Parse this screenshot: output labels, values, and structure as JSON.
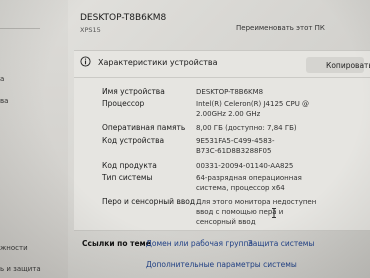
{
  "sidebar": {
    "items": [
      "а",
      "ва",
      "жности",
      "ь и защита"
    ]
  },
  "header": {
    "device_name": "DESKTOP-T8B6KM8",
    "model": "XPS15",
    "rename_label": "Переименовать этот ПК"
  },
  "panel": {
    "title": "Характеристики устройства",
    "copy_label": "Копировать",
    "rows": [
      {
        "label": "Имя устройства",
        "value": "DESKTOP-T8B6KM8"
      },
      {
        "label": "Процессор",
        "value": "Intel(R) Celeron(R) J4125 CPU @",
        "value2": "2.00GHz   2.00 GHz"
      },
      {
        "label": "Оперативная память",
        "value": "8,00 ГБ (доступно: 7,84 ГБ)"
      },
      {
        "label": "Код устройства",
        "value": "9E531FA5-C499-4583-",
        "value2": "B73C-61D8B3288F05"
      },
      {
        "label": "Код продукта",
        "value": "00331-20094-01140-AA825"
      },
      {
        "label": "Тип системы",
        "value": "64-разрядная операционная",
        "value2": "система, процессор x64"
      },
      {
        "label": "Перо и сенсорный ввод",
        "value": "Для этого монитора недоступен",
        "value2": "ввод с помощью пера и",
        "value3": "сенсорный ввод"
      }
    ]
  },
  "links": {
    "title": "Ссылки по теме",
    "items": [
      "Домен или рабочая группа",
      "Защита системы"
    ],
    "advanced": "Дополнительные параметры системы"
  },
  "colors": {
    "link": "#1e3f86",
    "panel": "#e6e5e1"
  }
}
